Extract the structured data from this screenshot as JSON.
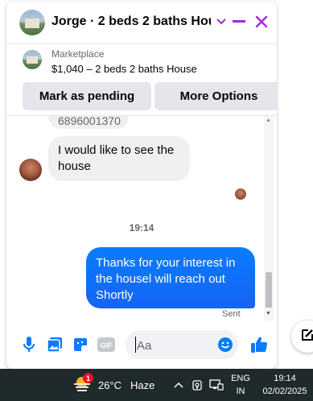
{
  "chat": {
    "title": "Jorge · 2 beds 2 baths Hou...",
    "marketplace_label": "Marketplace",
    "listing": "$1,040 – 2 beds 2 baths House",
    "actions": {
      "pending": "Mark as pending",
      "more": "More Options"
    },
    "messages": {
      "partial_number": "6896001370",
      "incoming": "I would like to see the house",
      "timestamp": "19:14",
      "outgoing": "Thanks for your interest in the housel will reach out Shortly",
      "status": "Sent"
    },
    "composer": {
      "placeholder": "Aa",
      "gif_label": "GIF"
    }
  },
  "taskbar": {
    "temperature": "26°C",
    "condition": "Haze",
    "weather_badge": "1",
    "lang_line1": "ENG",
    "lang_line2": "IN",
    "time": "19:14",
    "date": "02/02/2025"
  },
  "colors": {
    "accent": "#0a7cff",
    "close": "#a12bd6",
    "taskbar": "#1f2a2a"
  },
  "icons": [
    "house-thumbnail",
    "chevron-down-icon",
    "minimize-icon",
    "close-icon",
    "mic-icon",
    "photo-icon",
    "sticker-icon",
    "gif-icon",
    "emoji-icon",
    "thumbs-up-icon",
    "compose-icon",
    "weather-icon",
    "chevron-up-icon",
    "vpn-icon",
    "network-icon"
  ]
}
